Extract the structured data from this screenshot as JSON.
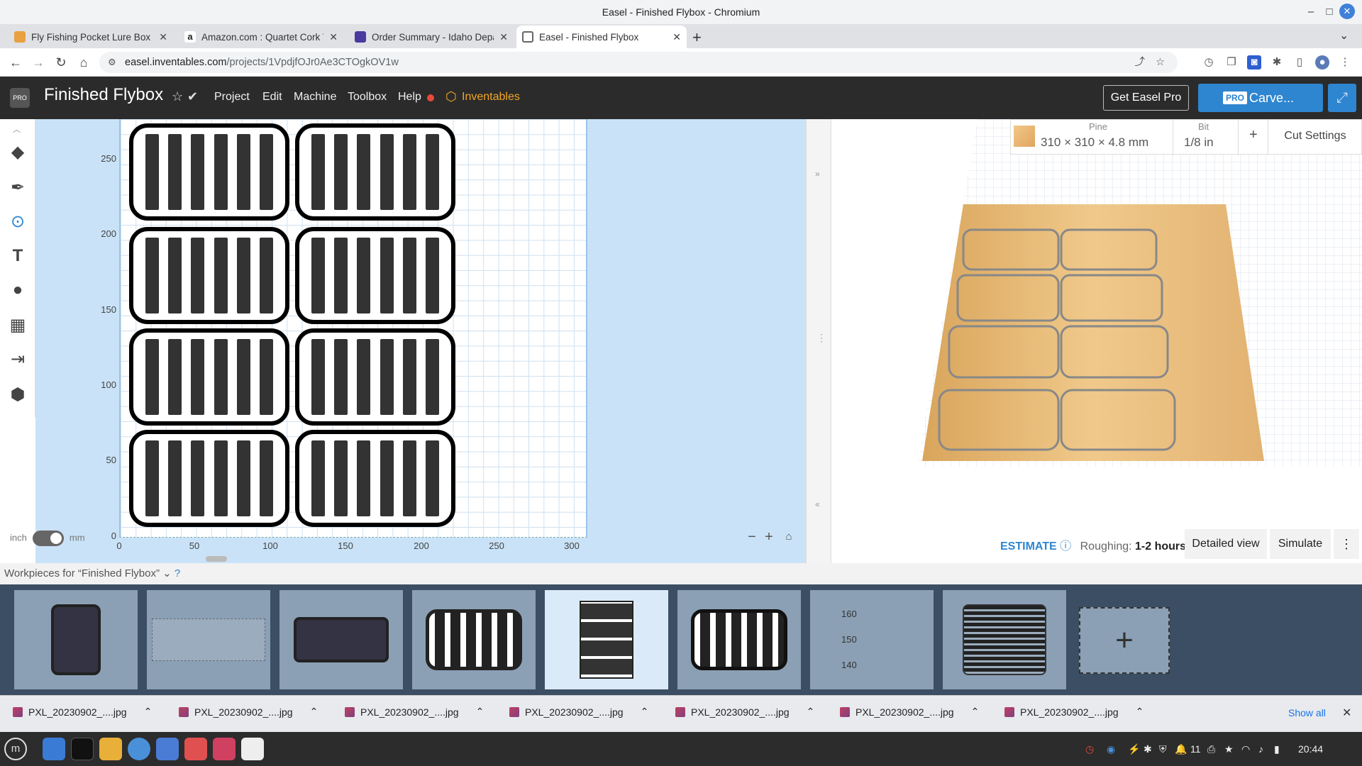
{
  "window": {
    "title": "Easel - Finished Flybox - Chromium"
  },
  "tabs": [
    {
      "label": "Fly Fishing Pocket Lure Box - I",
      "color": "#e8a040"
    },
    {
      "label": "Amazon.com : Quartet Cork T",
      "color": "#222222"
    },
    {
      "label": "Order Summary - Idaho Depar",
      "color": "#4a3aa0"
    },
    {
      "label": "Easel - Finished Flybox",
      "color": "#dddddd"
    }
  ],
  "url": {
    "domain": "easel.inventables.com",
    "path": "/projects/1VpdjfOJr0Ae3CTOgkOV1w"
  },
  "app": {
    "project_name": "Finished Flybox",
    "menu": [
      "Project",
      "Edit",
      "Machine",
      "Toolbox",
      "Help"
    ],
    "brand": "Inventables",
    "get_pro": "Get Easel Pro",
    "pro_badge": "PRO",
    "carve": "Carve..."
  },
  "canvas": {
    "y_ticks": [
      "250",
      "200",
      "150",
      "100",
      "50",
      "0"
    ],
    "x_ticks": [
      "0",
      "50",
      "100",
      "150",
      "200",
      "250",
      "300"
    ],
    "unit_left": "inch",
    "unit_right": "mm",
    "selected_unit": "mm"
  },
  "material": {
    "label": "Pine",
    "dimensions": "310 × 310 × 4.8 mm",
    "bit_label": "Bit",
    "bit_value": "1/8 in",
    "add": "+",
    "cut_settings": "Cut Settings"
  },
  "estimate": {
    "label": "ESTIMATE",
    "roughing_label": "Roughing:",
    "roughing_value": "1-2 hours",
    "detailed_view": "Detailed view",
    "simulate": "Simulate"
  },
  "workpieces": {
    "header": "Workpieces for “Finished Flybox”",
    "thumb_labels": [
      "160",
      "150",
      "140"
    ]
  },
  "downloads": {
    "files": [
      "PXL_20230902_....jpg",
      "PXL_20230902_....jpg",
      "PXL_20230902_....jpg",
      "PXL_20230902_....jpg",
      "PXL_20230902_....jpg",
      "PXL_20230902_....jpg",
      "PXL_20230902_....jpg"
    ],
    "show_all": "Show all"
  },
  "taskbar": {
    "clock": "20:44",
    "tray_count": "11"
  }
}
